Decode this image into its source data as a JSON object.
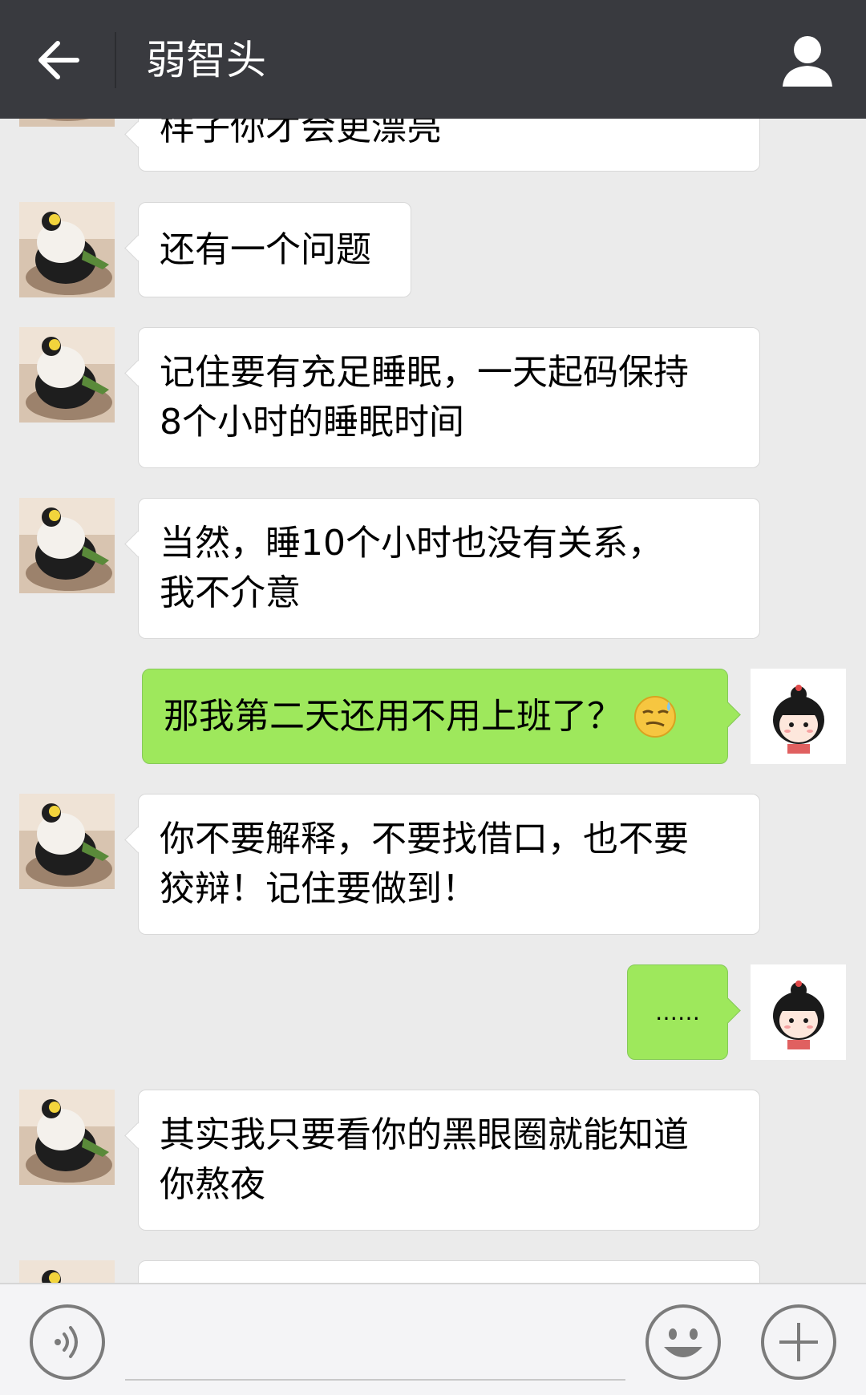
{
  "header": {
    "title": "弱智头"
  },
  "messages": {
    "m0": {
      "side": "in",
      "text": "样子你才会更漂亮"
    },
    "m1": {
      "side": "in",
      "text": "还有一个问题"
    },
    "m2": {
      "side": "in",
      "line1": "记住要有充足睡眠，一天起码保持",
      "line2": "8个小时的睡眠时间"
    },
    "m3": {
      "side": "in",
      "line1": "当然，睡10个小时也没有关系，",
      "line2": "我不介意"
    },
    "m4": {
      "side": "out",
      "text": "那我第二天还用不用上班了？",
      "emoji": "sweat-smirk-emoji"
    },
    "m5": {
      "side": "in",
      "line1": "你不要解释，不要找借口，也不要",
      "line2": "狡辩！记住要做到！"
    },
    "m6": {
      "side": "out",
      "text": "……"
    },
    "m7": {
      "side": "in",
      "line1": "其实我只要看你的黑眼圈就能知道",
      "line2": "你熬夜"
    }
  },
  "icons": {
    "back": "back-arrow-icon",
    "profile": "person-icon",
    "voice": "voice-icon",
    "emoji": "smiley-icon",
    "more": "plus-icon"
  },
  "colors": {
    "header_bg": "#393a3f",
    "chat_bg": "#ebebeb",
    "incoming_bubble": "#ffffff",
    "outgoing_bubble": "#9ee85c"
  }
}
